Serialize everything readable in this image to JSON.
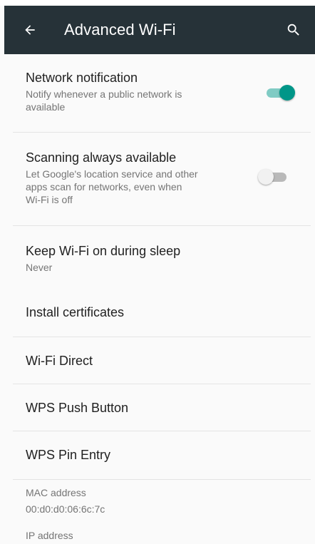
{
  "appbar": {
    "title": "Advanced Wi-Fi",
    "back_icon": "arrow-back-icon",
    "search_icon": "search-icon",
    "color": "#263238"
  },
  "settings": {
    "network_notification": {
      "title": "Network notification",
      "subtitle_line1": "Notify whenever a public network is",
      "subtitle_line2": "available",
      "toggle_on": true
    },
    "scanning": {
      "title": "Scanning always available",
      "subtitle_line1": "Let Google's location service and other",
      "subtitle_line2": "apps scan for networks, even when",
      "subtitle_line3": "Wi-Fi is off",
      "toggle_on": false
    },
    "keep_wifi": {
      "title": "Keep Wi-Fi on during sleep",
      "value": "Never"
    },
    "install_certificates": {
      "title": "Install certificates"
    },
    "wifi_direct": {
      "title": "Wi-Fi Direct"
    },
    "wps_push": {
      "title": "WPS Push Button"
    },
    "wps_pin": {
      "title": "WPS Pin Entry"
    }
  },
  "info": {
    "mac_label": "MAC address",
    "mac_value": "00:d0:d0:06:6c:7c",
    "ip_label": "IP address"
  },
  "colors": {
    "accent": "#009688",
    "accent_track": "#80cbc4",
    "switch_off_thumb": "#f1f1f1",
    "switch_off_track": "#b9b9b9"
  }
}
